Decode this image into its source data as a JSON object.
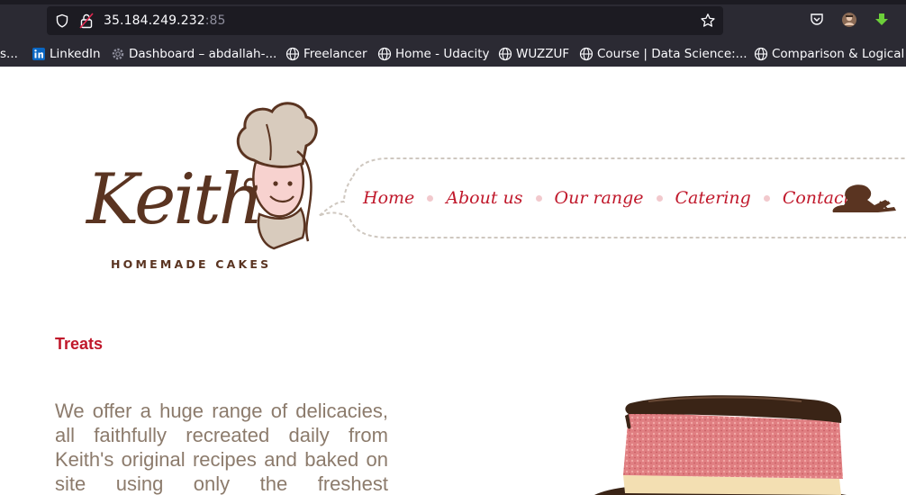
{
  "browser": {
    "url_host": "35.184.249.232",
    "url_port": ":85",
    "bookmarks": [
      {
        "label": "s...",
        "icon": "none"
      },
      {
        "label": "LinkedIn",
        "icon": "linkedin-icon"
      },
      {
        "label": "Dashboard – abdallah-...",
        "icon": "gear-icon"
      },
      {
        "label": "Freelancer",
        "icon": "globe-icon"
      },
      {
        "label": "Home - Udacity",
        "icon": "globe-icon"
      },
      {
        "label": "WUZZUF",
        "icon": "globe-icon"
      },
      {
        "label": "Course | Data Science:...",
        "icon": "globe-icon"
      },
      {
        "label": "Comparison & Logical ...",
        "icon": "globe-icon"
      }
    ]
  },
  "site": {
    "logo_text": "Keith",
    "logo_subtitle": "HOMEMADE CAKES",
    "nav": [
      "Home",
      "About us",
      "Our range",
      "Catering",
      "Contact"
    ],
    "section_title": "Treats",
    "intro": "We offer a huge range of delicacies, all faithfully recreated daily from Keith's original recipes and baked on site using only the freshest"
  },
  "colors": {
    "brand_brown": "#5a3421",
    "brand_red": "#c0182b",
    "body_text": "#8c7b6c"
  }
}
